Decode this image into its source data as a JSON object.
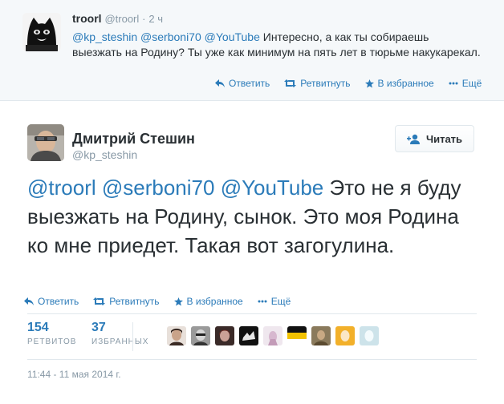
{
  "parent_tweet": {
    "name": "troorl",
    "handle": "@troorl",
    "separator": "·",
    "time": "2 ч",
    "mentions": [
      "@kp_steshin",
      "@serboni70",
      "@YouTube"
    ],
    "text": "Интересно, а как ты собираешь выезжать на Родину? Ты уже как минимум на пять лет в тюрьме накукарекал.",
    "actions": {
      "reply": "Ответить",
      "retweet": "Ретвитнуть",
      "favorite": "В избранное",
      "more": "Ещё"
    }
  },
  "main_tweet": {
    "fullname": "Дмитрий Стешин",
    "screenname": "@kp_steshin",
    "follow_label": "Читать",
    "mentions": [
      "@troorl",
      "@serboni70",
      "@YouTube"
    ],
    "text": "Это не я буду выезжать на Родину, сынок. Это моя Родина ко мне приедет. Такая вот загогулина.",
    "actions": {
      "reply": "Ответить",
      "retweet": "Ретвитнуть",
      "favorite": "В избранное",
      "more": "Ещё"
    },
    "stats": {
      "retweets": {
        "count": "154",
        "label": "РЕТВИТОВ"
      },
      "favorites": {
        "count": "37",
        "label": "ИЗБРАННЫХ"
      }
    },
    "timestamp": "11:44 - 11 мая 2014 г."
  },
  "colors": {
    "link": "#2b7bb9",
    "muted": "#8899a6",
    "text": "#292f33",
    "parent_bg": "#f5f8fa",
    "border": "#e1e8ed"
  },
  "icons": [
    "reply-icon",
    "retweet-icon",
    "star-icon",
    "more-dots-icon",
    "follow-person-plus-icon"
  ]
}
